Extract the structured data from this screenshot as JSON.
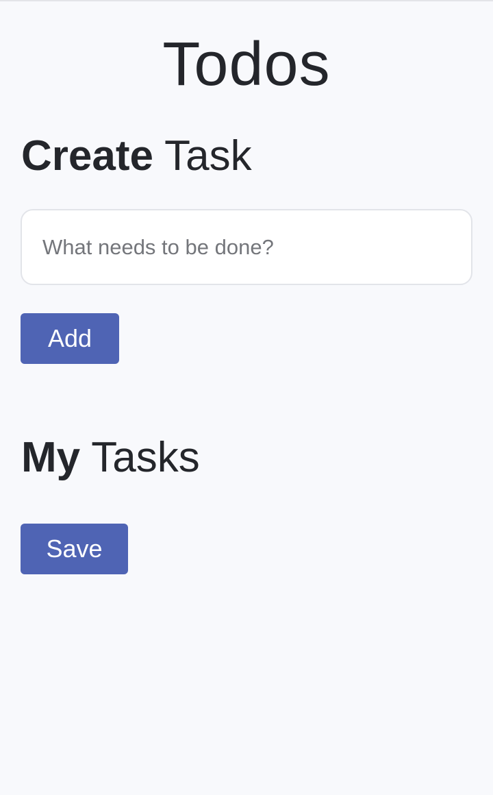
{
  "header": {
    "title": "Todos"
  },
  "create_section": {
    "heading_strong": "Create",
    "heading_rest": "Task",
    "input_value": "",
    "input_placeholder": "What needs to be done?",
    "add_label": "Add"
  },
  "tasks_section": {
    "heading_strong": "My",
    "heading_rest": "Tasks",
    "save_label": "Save"
  },
  "colors": {
    "background": "#f8f9fc",
    "text": "#24262b",
    "button": "#4f64b4",
    "button_text": "#ffffff",
    "input_border": "#e2e4e9"
  }
}
